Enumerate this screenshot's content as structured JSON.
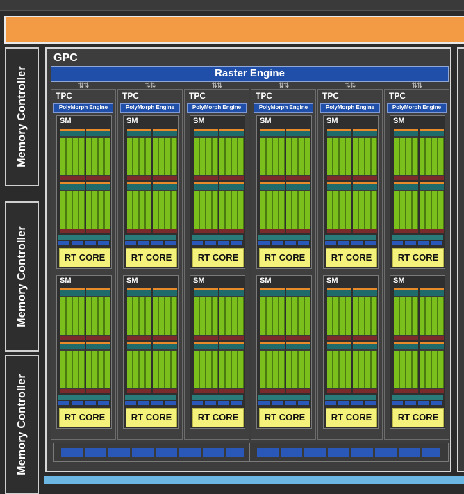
{
  "labels": {
    "memory_controller": "Memory Controller",
    "gpc": "GPC",
    "raster_engine": "Raster Engine",
    "tpc": "TPC",
    "polymorph_engine": "PolyMorph Engine",
    "sm": "SM",
    "rt_core": "RT CORE"
  },
  "colors": {
    "orange_bar": "#f39a44",
    "raster_blue": "#1f4fa8",
    "cuda_green": "#7bbf1c",
    "rt_core_yellow": "#f4f27a",
    "bottom_blue": "#6cb6e4"
  },
  "counts": {
    "tpcs": 6,
    "sms_per_tpc": 2,
    "l2_groups": 2
  }
}
